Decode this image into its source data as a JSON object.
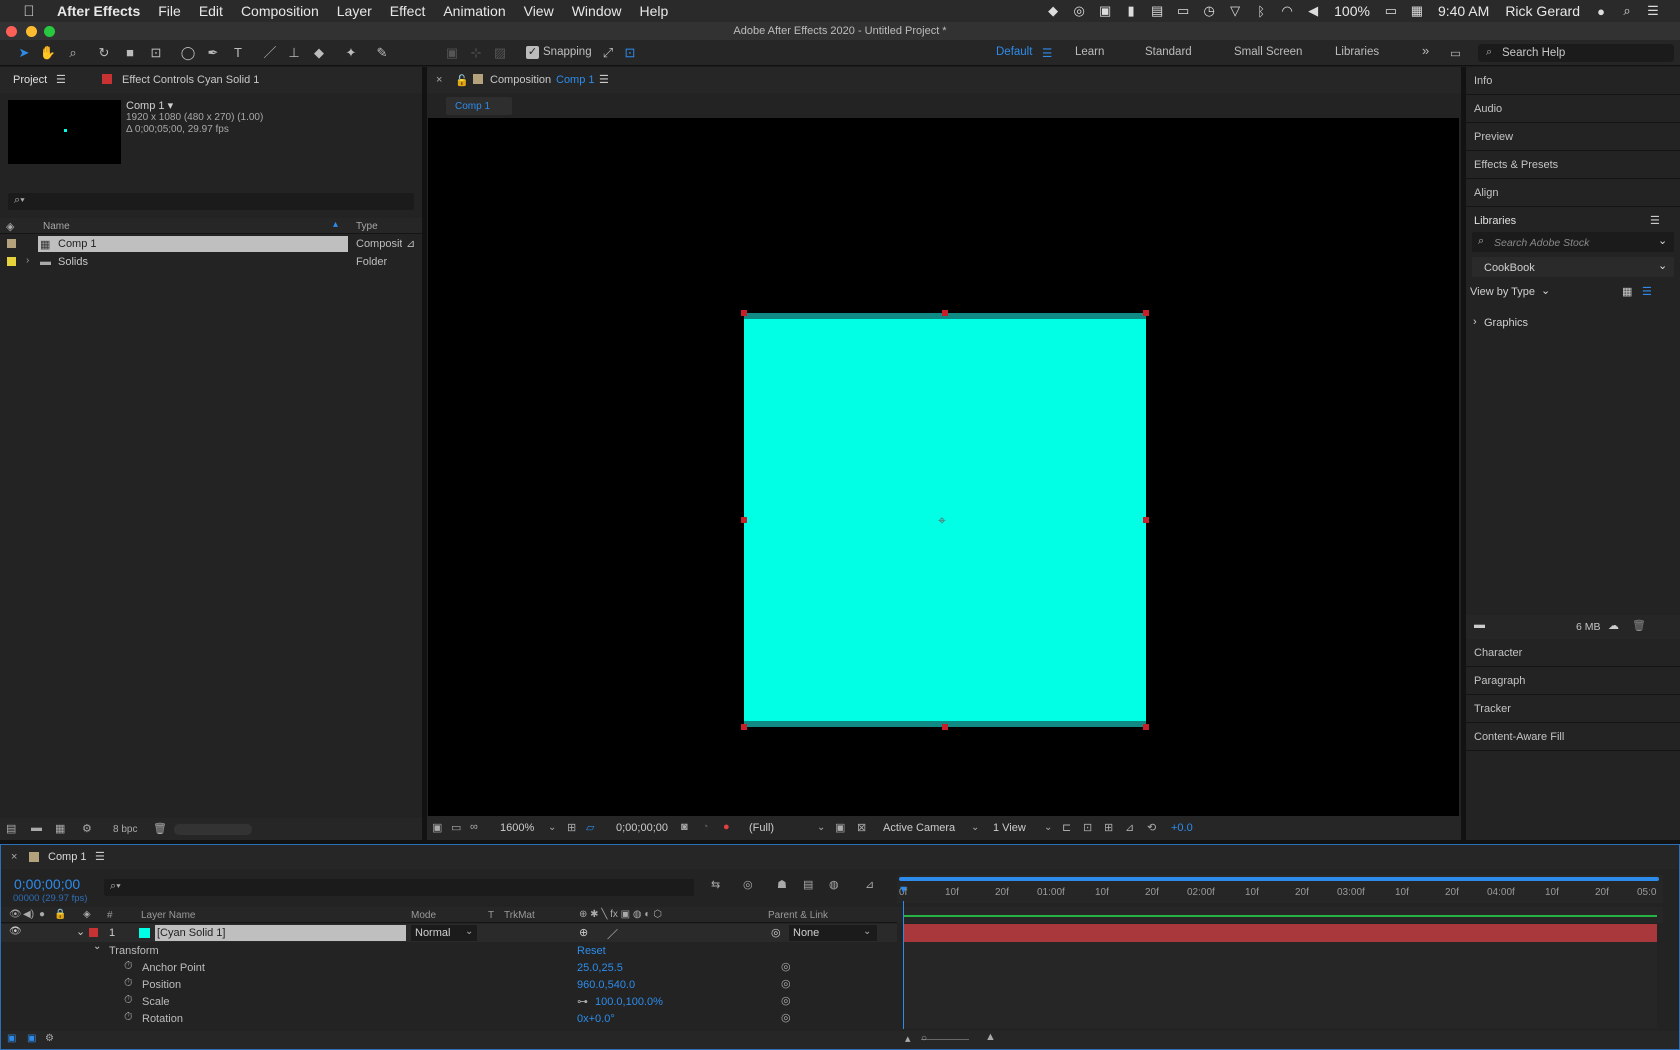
{
  "menubar": {
    "app": "After Effects",
    "items": [
      "File",
      "Edit",
      "Composition",
      "Layer",
      "Effect",
      "Animation",
      "View",
      "Window",
      "Help"
    ],
    "battery": "100%",
    "clock": "9:40 AM",
    "user": "Rick Gerard"
  },
  "window": {
    "title": "Adobe After Effects 2020 - Untitled Project *"
  },
  "toolbar": {
    "snapping": "Snapping",
    "workspaces": [
      "Default",
      "Learn",
      "Standard",
      "Small Screen",
      "Libraries"
    ],
    "search_placeholder": "Search Help"
  },
  "project": {
    "tab": "Project",
    "effect_tab": "Effect Controls Cyan Solid 1",
    "comp_name": "Comp 1 ▾",
    "comp_info1": "1920 x 1080  (480 x 270) (1.00)",
    "comp_info2": "Δ 0;00;05;00, 29.97 fps",
    "col_name": "Name",
    "col_type": "Type",
    "rows": [
      {
        "name": "Comp 1",
        "type": "Compositi",
        "color": "#b4a27c"
      },
      {
        "name": "Solids",
        "type": "Folder",
        "color": "#e6d23c"
      }
    ],
    "bpc": "8 bpc"
  },
  "comp": {
    "tab_prefix": "Composition",
    "tab_name": "Comp 1",
    "breadcrumb": "Comp 1",
    "zoom": "1600%",
    "timecode": "0;00;00;00",
    "resolution": "(Full)",
    "camera": "Active Camera",
    "views": "1 View",
    "exposure": "+0.0",
    "solid_color": "#00ffe5"
  },
  "right": {
    "items": [
      "Info",
      "Audio",
      "Preview",
      "Effects & Presets",
      "Align"
    ],
    "libraries": "Libraries",
    "search_stock": "Search Adobe Stock",
    "library": "CookBook",
    "view_by": "View by Type",
    "graphics": "Graphics",
    "storage": "6 MB",
    "items2": [
      "Character",
      "Paragraph",
      "Tracker",
      "Content-Aware Fill"
    ]
  },
  "timeline": {
    "tab": "Comp 1",
    "timecode": "0;00;00;00",
    "frames": "00000 (29.97 fps)",
    "headers": {
      "num": "#",
      "layer_name": "Layer Name",
      "mode": "Mode",
      "t": "T",
      "trkmat": "TrkMat",
      "parent": "Parent & Link"
    },
    "ruler": [
      "0f",
      "10f",
      "20f",
      "01:00f",
      "10f",
      "20f",
      "02:00f",
      "10f",
      "20f",
      "03:00f",
      "10f",
      "20f",
      "04:00f",
      "10f",
      "20f",
      "05:0"
    ],
    "layer": {
      "num": "1",
      "name": "[Cyan Solid 1]",
      "mode": "Normal",
      "parent": "None"
    },
    "transform": "Transform",
    "reset": "Reset",
    "props": [
      {
        "name": "Anchor Point",
        "value": "25.0,25.5"
      },
      {
        "name": "Position",
        "value": "960.0,540.0"
      },
      {
        "name": "Scale",
        "value": "100.0,100.0%"
      },
      {
        "name": "Rotation",
        "value": "0x+0.0°"
      }
    ]
  }
}
